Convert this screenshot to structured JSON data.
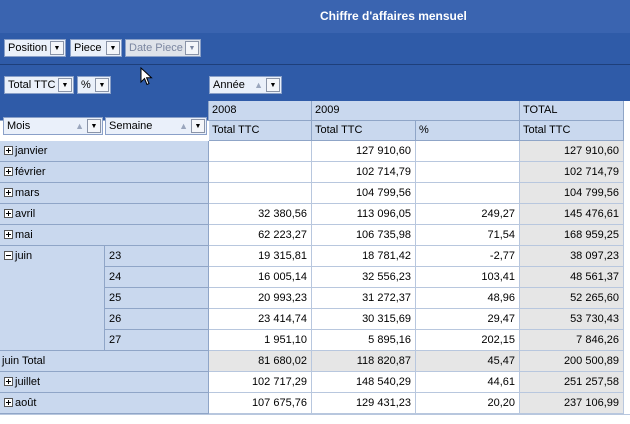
{
  "title": "Chiffre d'affaires mensuel",
  "filter_fields": [
    {
      "label": "Position",
      "enabled": true
    },
    {
      "label": "Piece",
      "enabled": true
    },
    {
      "label": "Date Piece",
      "enabled": false
    }
  ],
  "data_fields": [
    {
      "label": "Total TTC"
    },
    {
      "label": "%"
    }
  ],
  "column_field": {
    "label": "Année"
  },
  "row_fields": [
    {
      "label": "Mois"
    },
    {
      "label": "Semaine"
    }
  ],
  "column_headers": {
    "years": [
      "2008",
      "2009",
      "TOTAL"
    ],
    "measures": [
      "Total TTC",
      "Total TTC",
      "%",
      "Total TTC"
    ]
  },
  "rows": [
    {
      "month": "janvier",
      "expander": "plus",
      "week": "",
      "v2008": "",
      "v2009": "127 910,60",
      "pct": "",
      "total": "127 910,60"
    },
    {
      "month": "février",
      "expander": "plus",
      "week": "",
      "v2008": "",
      "v2009": "102 714,79",
      "pct": "",
      "total": "102 714,79"
    },
    {
      "month": "mars",
      "expander": "plus",
      "week": "",
      "v2008": "",
      "v2009": "104 799,56",
      "pct": "",
      "total": "104 799,56"
    },
    {
      "month": "avril",
      "expander": "plus",
      "week": "",
      "v2008": "32 380,56",
      "v2009": "113 096,05",
      "pct": "249,27",
      "total": "145 476,61"
    },
    {
      "month": "mai",
      "expander": "plus",
      "week": "",
      "v2008": "62 223,27",
      "v2009": "106 735,98",
      "pct": "71,54",
      "total": "168 959,25"
    },
    {
      "month": "juin",
      "expander": "minus",
      "week": "23",
      "v2008": "19 315,81",
      "v2009": "18 781,42",
      "pct": "-2,77",
      "total": "38 097,23"
    },
    {
      "month": "",
      "expander": "",
      "week": "24",
      "v2008": "16 005,14",
      "v2009": "32 556,23",
      "pct": "103,41",
      "total": "48 561,37"
    },
    {
      "month": "",
      "expander": "",
      "week": "25",
      "v2008": "20 993,23",
      "v2009": "31 272,37",
      "pct": "48,96",
      "total": "52 265,60"
    },
    {
      "month": "",
      "expander": "",
      "week": "26",
      "v2008": "23 414,74",
      "v2009": "30 315,69",
      "pct": "29,47",
      "total": "53 730,43"
    },
    {
      "month": "",
      "expander": "",
      "week": "27",
      "v2008": "1 951,10",
      "v2009": "5 895,16",
      "pct": "202,15",
      "total": "7 846,26"
    },
    {
      "month": "juin Total",
      "expander": "",
      "week": "",
      "v2008": "81 680,02",
      "v2009": "118 820,87",
      "pct": "45,47",
      "total": "200 500,89",
      "subtotal": true
    },
    {
      "month": "juillet",
      "expander": "plus",
      "week": "",
      "v2008": "102 717,29",
      "v2009": "148 540,29",
      "pct": "44,61",
      "total": "251 257,58"
    },
    {
      "month": "août",
      "expander": "plus",
      "week": "",
      "v2008": "107 675,76",
      "v2009": "129 431,23",
      "pct": "20,20",
      "total": "237 106,99"
    }
  ],
  "icons": {
    "dropdown": "chevron-down-icon",
    "sort": "sort-arrow-icon",
    "expand": "plus-box-icon",
    "collapse": "minus-box-icon",
    "cursor": "mouse-pointer-icon"
  },
  "colors": {
    "title_bar": "#3a64b0",
    "toolbar": "#2f5ba8",
    "header_cell": "#c9d8ee",
    "total_column": "#e6e6e6"
  }
}
